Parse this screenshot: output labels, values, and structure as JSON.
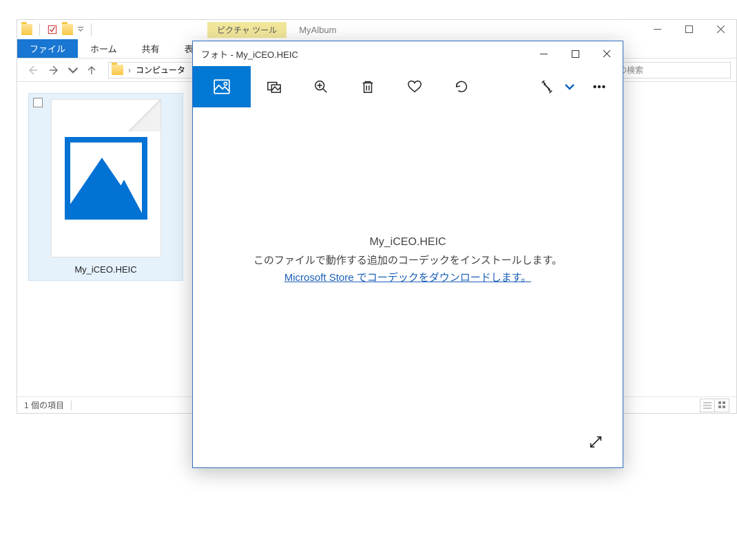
{
  "explorer": {
    "contextTab": "ピクチャ ツール",
    "title": "MyAlbum",
    "tabs": {
      "file": "ファイル",
      "home": "ホーム",
      "share": "共有",
      "view": "表示"
    },
    "breadcrumb": {
      "seg1": "コンピュータ"
    },
    "search": {
      "placeholder": "の検索"
    },
    "file": {
      "name": "My_iCEO.HEIC"
    },
    "status": {
      "count": "1 個の項目"
    }
  },
  "photos": {
    "title": "フォト - My_iCEO.HEIC",
    "message": {
      "filename": "My_iCEO.HEIC",
      "line": "このファイルで動作する追加のコーデックをインストールします。",
      "link": "Microsoft Store でコーデックをダウンロードします。"
    }
  }
}
